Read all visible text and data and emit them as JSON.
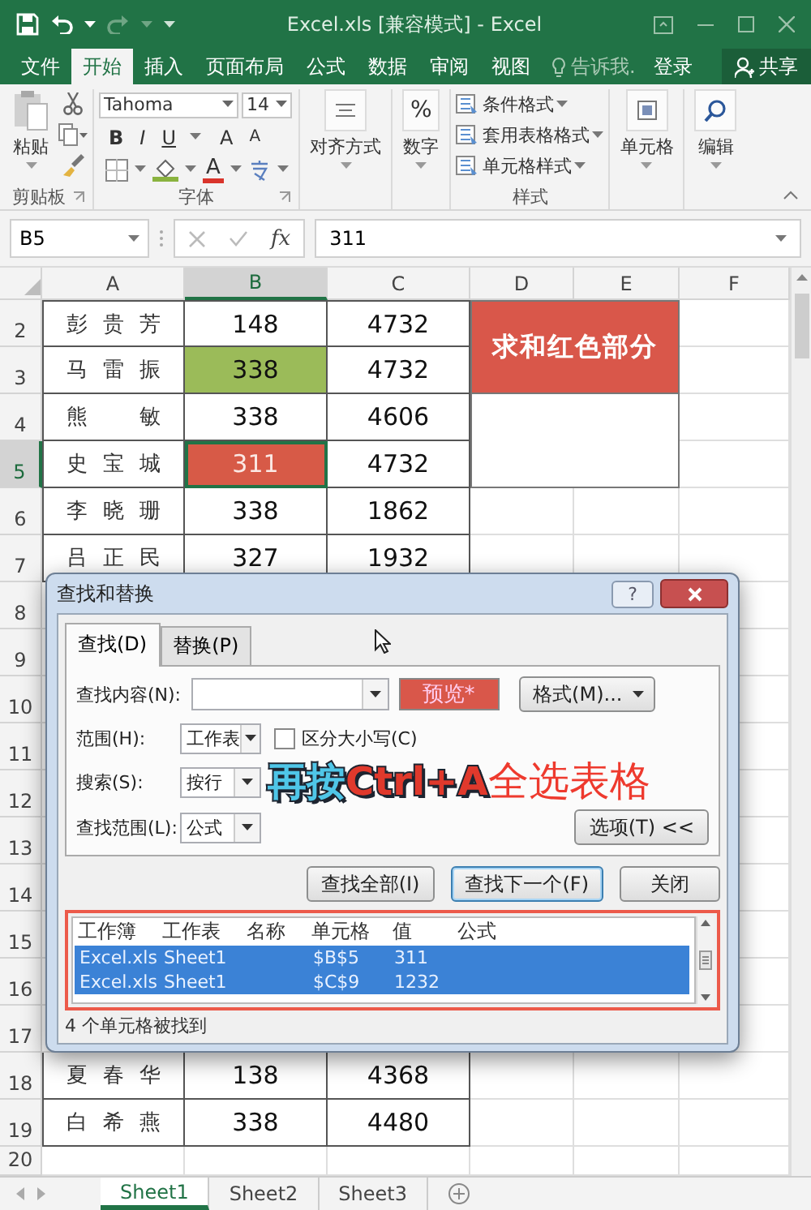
{
  "window": {
    "title": "Excel.xls  [兼容模式] - Excel"
  },
  "ribbon_tabs": [
    {
      "label": "文件",
      "selected": false
    },
    {
      "label": "开始",
      "selected": true
    },
    {
      "label": "插入",
      "selected": false
    },
    {
      "label": "页面布局",
      "selected": false
    },
    {
      "label": "公式",
      "selected": false
    },
    {
      "label": "数据",
      "selected": false
    },
    {
      "label": "审阅",
      "selected": false
    },
    {
      "label": "视图",
      "selected": false
    }
  ],
  "tell_me": "告诉我.",
  "sign_in": "登录",
  "share": "共享",
  "ribbon": {
    "clipboard": {
      "paste": "粘贴",
      "label": "剪贴板"
    },
    "font": {
      "name": "Tahoma",
      "size": "14",
      "buttons": [
        "B",
        "I",
        "U"
      ],
      "grow": "A",
      "shrink": "A",
      "font_color": "A",
      "label": "字体"
    },
    "alignment": {
      "label": "对齐方式"
    },
    "number": {
      "symbol": "%",
      "label": "数字"
    },
    "styles": {
      "items": [
        "条件格式",
        "套用表格格式",
        "单元格样式"
      ],
      "label": "样式"
    },
    "cells": {
      "label": "单元格"
    },
    "editing": {
      "label": "编辑"
    }
  },
  "formula_bar": {
    "name_box": "B5",
    "function_label": "fx",
    "value": "311"
  },
  "sheet": {
    "columns": [
      {
        "label": "A",
        "selected": false
      },
      {
        "label": "B",
        "selected": true
      },
      {
        "label": "C",
        "selected": false
      },
      {
        "label": "D",
        "selected": false
      },
      {
        "label": "E",
        "selected": false
      },
      {
        "label": "F",
        "selected": false
      }
    ],
    "rows": [
      {
        "number": "2",
        "selected": false,
        "cells": [
          {
            "text": "彭贵芳"
          },
          {
            "text": "148"
          },
          {
            "text": "4732"
          }
        ]
      },
      {
        "number": "3",
        "selected": false,
        "cells": [
          {
            "text": "马雷振"
          },
          {
            "text": "338",
            "color": "#9bbb59"
          },
          {
            "text": "4732"
          }
        ]
      },
      {
        "number": "4",
        "selected": false,
        "cells": [
          {
            "text": "熊敏"
          },
          {
            "text": "338"
          },
          {
            "text": "4606"
          }
        ]
      },
      {
        "number": "5",
        "selected": true,
        "cells": [
          {
            "text": "史宝城"
          },
          {
            "text": "311",
            "color": "#d75a47"
          },
          {
            "text": "4732"
          }
        ]
      },
      {
        "number": "6",
        "selected": false,
        "cells": [
          {
            "text": "李晓珊"
          },
          {
            "text": "338"
          },
          {
            "text": "1862"
          }
        ]
      },
      {
        "number": "7",
        "selected": false,
        "cells": [
          {
            "text": "吕正民"
          },
          {
            "text": "327"
          },
          {
            "text": "1932"
          }
        ]
      },
      {
        "number": "8",
        "selected": false
      },
      {
        "number": "9",
        "selected": false
      },
      {
        "number": "10",
        "selected": false
      },
      {
        "number": "11",
        "selected": false
      },
      {
        "number": "12",
        "selected": false
      },
      {
        "number": "13",
        "selected": false
      },
      {
        "number": "14",
        "selected": false
      },
      {
        "number": "15",
        "selected": false
      },
      {
        "number": "16",
        "selected": false
      },
      {
        "number": "17",
        "selected": false
      },
      {
        "number": "18",
        "selected": false,
        "cells": [
          {
            "text": "夏春华"
          },
          {
            "text": "138"
          },
          {
            "text": "4368"
          }
        ]
      },
      {
        "number": "19",
        "selected": false,
        "cells": [
          {
            "text": "白希燕"
          },
          {
            "text": "338"
          },
          {
            "text": "4480"
          }
        ]
      },
      {
        "number": "20",
        "selected": false
      }
    ],
    "note": {
      "text": "求和红色部分",
      "color": "#d9574a"
    },
    "tabs": [
      {
        "label": "Sheet1",
        "selected": true
      },
      {
        "label": "Sheet2",
        "selected": false
      },
      {
        "label": "Sheet3",
        "selected": false
      }
    ]
  },
  "dialog": {
    "title": "查找和替换",
    "help": "?",
    "tabs": [
      {
        "label": "查找(D)",
        "selected": true
      },
      {
        "label": "替换(P)",
        "selected": false
      }
    ],
    "find_label": "查找内容(N):",
    "preview": "预览*",
    "format_button": "格式(M)...",
    "options": [
      {
        "label": "范围(H):",
        "value": "工作表"
      },
      {
        "label": "搜索(S):",
        "value": "按行"
      },
      {
        "label": "查找范围(L):",
        "value": "公式"
      }
    ],
    "match_case": {
      "label": "区分大小写(C)",
      "checked": false
    },
    "options_button": "选项(T) <<",
    "buttons": [
      {
        "label": "查找全部(I)",
        "default": false
      },
      {
        "label": "查找下一个(F)",
        "default": true
      },
      {
        "label": "关闭",
        "default": false
      }
    ],
    "results": {
      "columns": [
        "工作簿",
        "工作表",
        "名称",
        "单元格",
        "值",
        "公式"
      ],
      "rows": [
        {
          "selected": true,
          "workbook": "Excel.xls",
          "sheet": "Sheet1",
          "cell": "$B$5",
          "value": "311"
        },
        {
          "selected": true,
          "workbook": "Excel.xls",
          "sheet": "Sheet1",
          "cell": "$C$9",
          "value": "1232"
        }
      ]
    },
    "status": "4 个单元格被找到"
  },
  "caption": [
    {
      "text": "再按",
      "color": "#4fc6e8",
      "outlined": true
    },
    {
      "text": "Ctrl+A",
      "color": "#e0392c",
      "outlined": true
    },
    {
      "text": "全选表格",
      "color": "#ee3a2e",
      "outlined": false
    }
  ]
}
